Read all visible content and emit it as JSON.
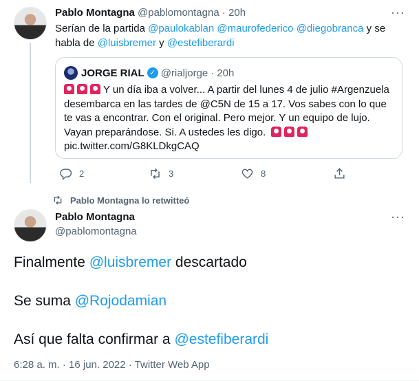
{
  "tweet1": {
    "author_name": "Pablo Montagna",
    "author_handle": "@pablomontagna",
    "separator": "·",
    "time": "20h",
    "more": "···",
    "text": {
      "t1": "Serían de la partida ",
      "m1": "@paulokablan",
      "m2": "@maurofederico",
      "m3": "@diegobranca",
      "t2": " y se habla de ",
      "m4": "@luisbremer",
      "t3": " y ",
      "m5": "@estefiberardi"
    },
    "quote": {
      "name": "JORGE RIAL",
      "handle": "@rialjorge",
      "separator": "·",
      "time": "20h",
      "verified_icon": "✓",
      "body": "Y un día iba a volver... A partir del lunes 4 de julio #Argenzuela desembarca en las tardes de @C5N de 15 a 17. Vos sabes con lo que te vas a encontrar. Con el original. Pero mejor. Y un equipo de lujo. Vayan preparándose. Si. A ustedes les digo.",
      "link": "pic.twitter.com/G8KLDkgCAQ",
      "emoji": "siren-emoji"
    },
    "actions": {
      "replies": "2",
      "retweets": "3",
      "likes": "8"
    }
  },
  "retweet_label": "Pablo Montagna lo retwitteó",
  "tweet2": {
    "author_name": "Pablo Montagna",
    "author_handle": "@pablomontagna",
    "more": "···",
    "line1_pre": "Finalmente ",
    "line1_mention": "@luisbremer",
    "line1_post": " descartado",
    "line2_pre": "Se suma ",
    "line2_mention": "@Rojodamian",
    "line3_pre": "Así que falta confirmar a ",
    "line3_mention": "@estefiberardi",
    "meta": "6:28 a. m. · 16 jun. 2022 · Twitter Web App"
  },
  "colors": {
    "accent": "#1d9bf0",
    "muted": "#536471",
    "text": "#0f1419"
  }
}
